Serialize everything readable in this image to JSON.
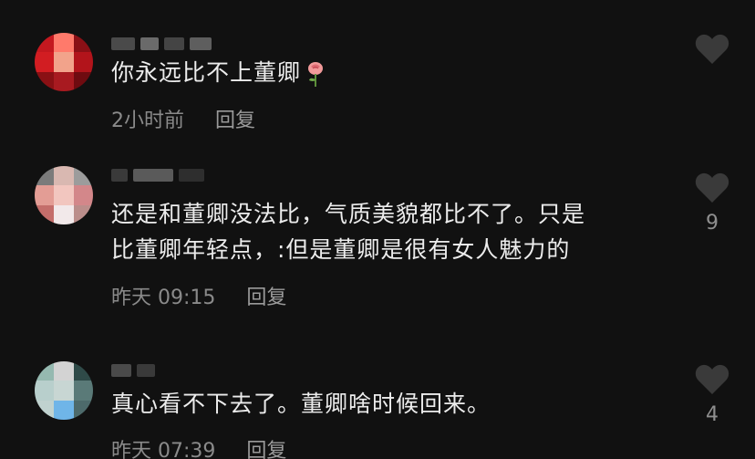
{
  "comments": [
    {
      "text": "你永远比不上董卿",
      "emoji": "rose-emoji",
      "time": "2小时前",
      "reply_label": "回复",
      "likes": "",
      "avatar_colors": [
        "#c4181f",
        "#ff7a6b",
        "#8a1016",
        "#d21d22",
        "#f2a38b",
        "#b2141b",
        "#8a1014",
        "#a81a20",
        "#6f0b10"
      ]
    },
    {
      "text_line1": "还是和董卿没法比，气质美貌都比不了。只是",
      "text_line2": "比董卿年轻点，:但是董卿是很有女人魅力的",
      "time": "昨天 09:15",
      "reply_label": "回复",
      "likes": "9",
      "avatar_colors": [
        "#7b7b7b",
        "#d9b8b1",
        "#9c9c9c",
        "#e39d95",
        "#f2c6bf",
        "#d3878a",
        "#c46e6b",
        "#f2e9ea",
        "#bb8e8b"
      ]
    },
    {
      "text": "真心看不下去了。董卿啥时候回来。",
      "time": "昨天 07:39",
      "reply_label": "回复",
      "likes": "4",
      "avatar_colors": [
        "#95b9b0",
        "#d3d3d3",
        "#2f4a48",
        "#b8cfcc",
        "#c8d6d3",
        "#5a7a78",
        "#c0d2cf",
        "#6fb5e8",
        "#4d6a6b"
      ]
    }
  ],
  "colors": {
    "background": "#111111",
    "text": "#ececec",
    "meta": "#8a8a8a",
    "heart": "#3a3a3a"
  }
}
